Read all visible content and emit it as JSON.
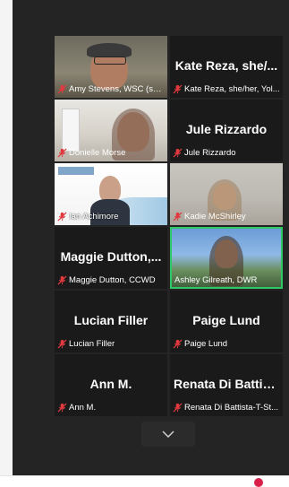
{
  "participants": [
    {
      "display_name": "",
      "label": "Amy Stevens, WSC (sh...",
      "muted": true,
      "video": "amy"
    },
    {
      "display_name": "Kate Reza, she/...",
      "label": "Kate Reza, she/her, Yol...",
      "muted": true,
      "video": ""
    },
    {
      "display_name": "",
      "label": "Donielle Morse",
      "muted": true,
      "video": "donielle"
    },
    {
      "display_name": "Jule Rizzardo",
      "label": "Jule Rizzardo",
      "muted": true,
      "video": ""
    },
    {
      "display_name": "",
      "label": "Ian Achimore",
      "muted": true,
      "video": "ian"
    },
    {
      "display_name": "",
      "label": "Kadie McShirley",
      "muted": true,
      "video": "kadie"
    },
    {
      "display_name": "Maggie  Dutton,...",
      "label": "Maggie Dutton, CCWD",
      "muted": true,
      "video": ""
    },
    {
      "display_name": "",
      "label": "Ashley Gilreath, DWR",
      "muted": false,
      "video": "ashley",
      "active_speaker": true
    },
    {
      "display_name": "Lucian Filler",
      "label": "Lucian Filler",
      "muted": true,
      "video": ""
    },
    {
      "display_name": "Paige Lund",
      "label": "Paige Lund",
      "muted": true,
      "video": ""
    },
    {
      "display_name": "Ann M.",
      "label": "Ann M.",
      "muted": true,
      "video": ""
    },
    {
      "display_name": "Renata Di Battis...",
      "label": "Renata Di Battista-T-St...",
      "muted": true,
      "video": ""
    }
  ],
  "icons": {
    "mute": "mic-muted-icon",
    "scroll_down": "chevron-down-icon"
  },
  "colors": {
    "mute_red": "#e0393e",
    "active_speaker": "#2ec866",
    "tile_bg": "#1a1a1a",
    "app_bg": "#242424"
  }
}
